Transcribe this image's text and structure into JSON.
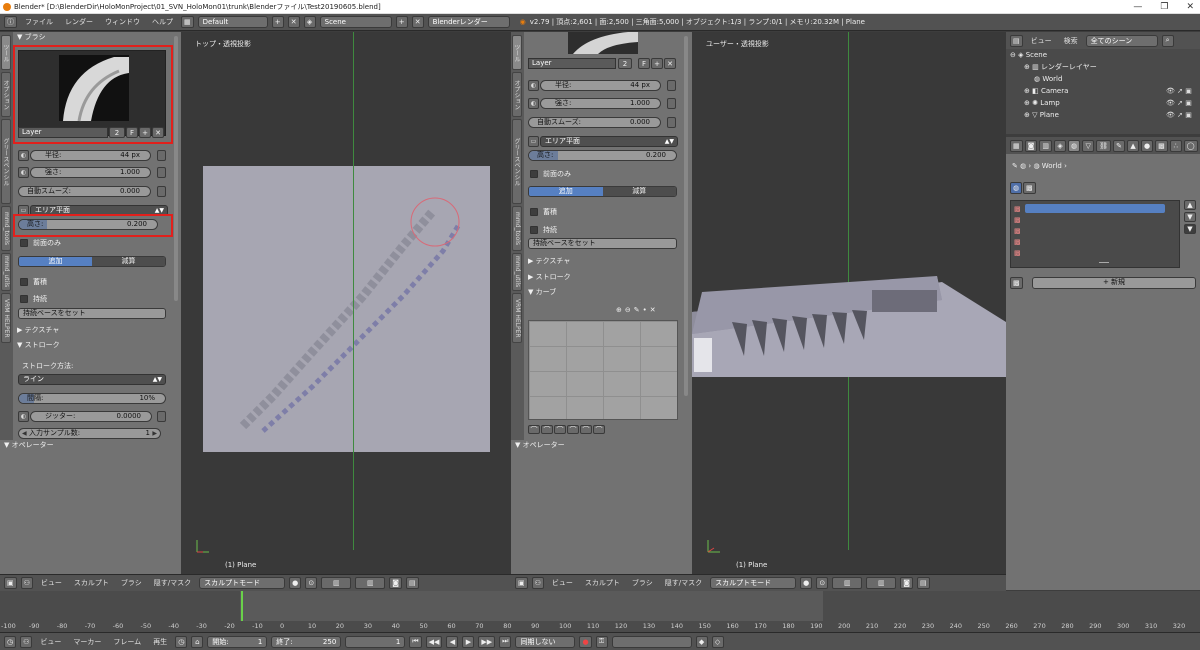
{
  "window": {
    "title": "Blender* [D:\\BlenderDir\\HoloMonProject\\01_SVN_HoloMon01\\trunk\\Blenderファイル\\Test20190605.blend]",
    "min": "—",
    "max": "❐",
    "close": "✕"
  },
  "topbar": {
    "menus": [
      "ファイル",
      "レンダー",
      "ウィンドウ",
      "ヘルプ"
    ],
    "layout": "Default",
    "scene": "Scene",
    "engine": "Blenderレンダー",
    "stats": "v2.79 | 頂点:2,601 | 面:2,500 | 三角面:5,000 | オブジェクト:1/3 | ランプ:0/1 | メモリ:20.32M | Plane"
  },
  "left_tabs": [
    "ツール",
    "オプション",
    "グリースペンシル",
    "mmd_tools",
    "mmd_utils",
    "VRM HELPER"
  ],
  "brush": {
    "header": "ブラシ",
    "layer_name": "Layer",
    "layer_users": "2",
    "fake": "F",
    "plus": "+",
    "x": "✕",
    "radius_label": "半径:",
    "radius_value": "44 px",
    "strength_label": "強さ:",
    "strength_value": "1.000",
    "autosmooth_label": "自動スムーズ:",
    "autosmooth_value": "0.000",
    "area_plane": "エリア平面",
    "height_label": "高さ:",
    "height_value": "0.200",
    "height_fraction": 0.2,
    "front_only": "前面のみ",
    "add": "追加",
    "subtract": "減算",
    "accumulate": "蓄積",
    "persistent": "持続",
    "set_persistent": "持続ベースをセット"
  },
  "texture_header": "テクスチャ",
  "stroke_header": "ストローク",
  "stroke_method_label": "ストローク方法:",
  "stroke_method": "ライン",
  "spacing_label": "間隔:",
  "spacing_value": "10%",
  "spacing_fraction": 0.1,
  "jitter_label": "ジッター:",
  "jitter_value": "0.0000",
  "input_samples_label": "入力サンプル数:",
  "input_samples_value": "1",
  "curve_header": "カーブ",
  "operator_header": "オペレーター",
  "viewport_left": {
    "title": "トップ・透視投影",
    "object": "(1) Plane"
  },
  "viewport_right": {
    "title": "ユーザー・透視投影",
    "object": "(1) Plane"
  },
  "vp_menus": [
    "ビュー",
    "スカルプト",
    "ブラシ",
    "隠す/マスク"
  ],
  "mode": "スカルプトモード",
  "outliner": {
    "menus": [
      "ビュー",
      "検索"
    ],
    "filter": "全てのシーン",
    "items": [
      "Scene",
      "レンダーレイヤー",
      "World",
      "Camera",
      "Lamp",
      "Plane"
    ]
  },
  "properties": {
    "breadcrumb": "World",
    "new_btn": "新規"
  },
  "timeline": {
    "ticks": [
      "-100",
      "-90",
      "-80",
      "-70",
      "-60",
      "-50",
      "-40",
      "-30",
      "-20",
      "-10",
      "0",
      "10",
      "20",
      "30",
      "40",
      "50",
      "60",
      "70",
      "80",
      "90",
      "100",
      "110",
      "120",
      "130",
      "140",
      "150",
      "160",
      "170",
      "180",
      "190",
      "200",
      "210",
      "220",
      "230",
      "240",
      "250",
      "260",
      "270",
      "280",
      "290",
      "300",
      "310",
      "320"
    ],
    "menus": [
      "ビュー",
      "マーカー",
      "フレーム",
      "再生"
    ],
    "start_label": "開始:",
    "start": "1",
    "end_label": "終了:",
    "end": "250",
    "current": "1",
    "sync": "同期しない"
  }
}
